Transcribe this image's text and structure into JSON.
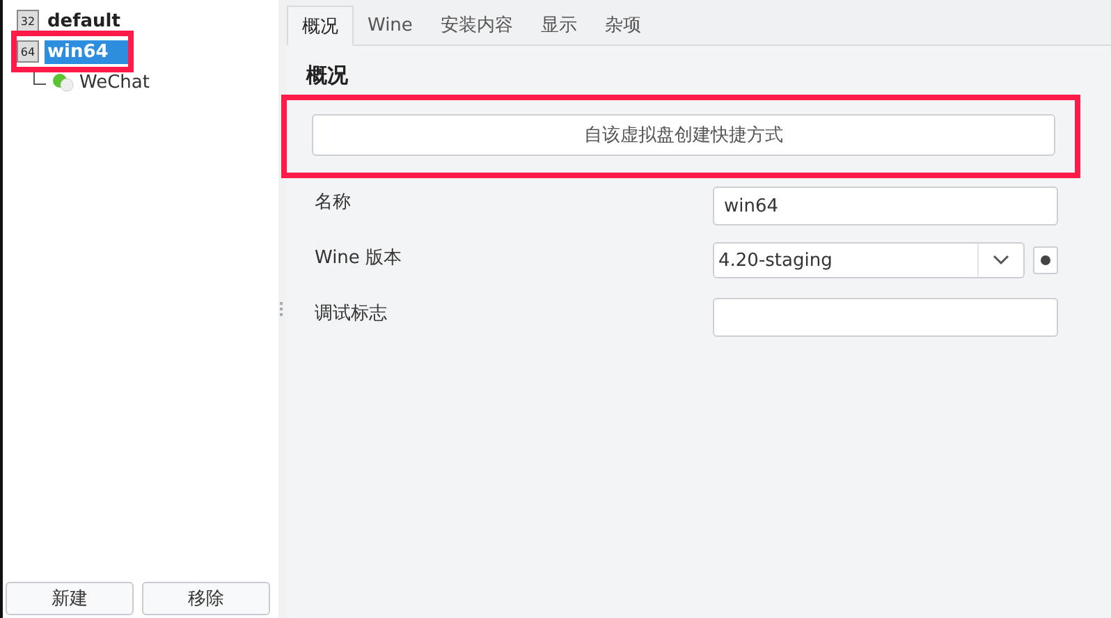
{
  "tree": [
    {
      "badge": "32",
      "label": "default",
      "selected": false,
      "highlighted": false
    },
    {
      "badge": "64",
      "label": "win64",
      "selected": true,
      "highlighted": true,
      "children": [
        {
          "label": "WeChat",
          "selected": false,
          "highlighted": false
        }
      ]
    }
  ],
  "sidebar_buttons": [
    "新建",
    "移除"
  ],
  "tabs": [
    {
      "label": "概况",
      "selected": true
    },
    {
      "label": "Wine",
      "selected": false
    },
    {
      "label": "安装内容",
      "selected": false
    },
    {
      "label": "显示",
      "selected": false
    },
    {
      "label": "杂项",
      "selected": false
    }
  ],
  "section_title": "概况",
  "shortcut_button": {
    "label": "自该虚拟盘创建快捷方式",
    "highlighted": true
  },
  "fields": [
    {
      "kind": "text",
      "label": "名称",
      "value": "win64"
    },
    {
      "kind": "select",
      "label": "Wine 版本",
      "value": "4.20-staging"
    },
    {
      "kind": "text",
      "label": "调试标志"
    }
  ]
}
